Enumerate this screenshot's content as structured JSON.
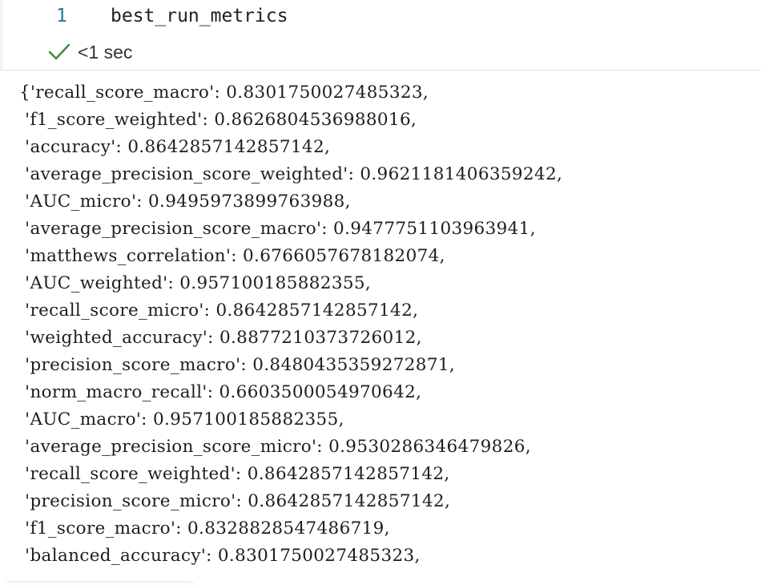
{
  "input": {
    "line_number": "1",
    "code": "best_run_metrics"
  },
  "status": {
    "icon": "check-icon",
    "color": "#3a8a3a",
    "time": "<1 sec"
  },
  "output": {
    "lines": [
      "{'recall_score_macro': 0.8301750027485323,",
      " 'f1_score_weighted': 0.8626804536988016,",
      " 'accuracy': 0.8642857142857142,",
      " 'average_precision_score_weighted': 0.9621181406359242,",
      " 'AUC_micro': 0.9495973899763988,",
      " 'average_precision_score_macro': 0.9477751103963941,",
      " 'matthews_correlation': 0.6766057678182074,",
      " 'AUC_weighted': 0.957100185882355,",
      " 'recall_score_micro': 0.8642857142857142,",
      " 'weighted_accuracy': 0.8877210373726012,",
      " 'precision_score_macro': 0.8480435359272871,",
      " 'norm_macro_recall': 0.6603500054970642,",
      " 'AUC_macro': 0.957100185882355,",
      " 'average_precision_score_micro': 0.9530286346479826,",
      " 'recall_score_weighted': 0.8642857142857142,",
      " 'precision_score_micro': 0.8642857142857142,",
      " 'f1_score_macro': 0.8328828547486719,",
      " 'balanced_accuracy': 0.8301750027485323,"
    ]
  }
}
